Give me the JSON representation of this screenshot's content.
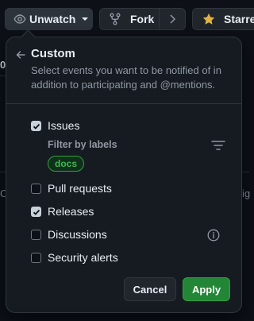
{
  "toolbar": {
    "watch_label": "Unwatch",
    "fork_label": "Fork",
    "star_label": "Starred"
  },
  "background": {
    "left_fragment_top": "0",
    "left_fragment_mid": "C",
    "right_fragment_mid": "ig"
  },
  "popover": {
    "title": "Custom",
    "description": "Select events you want to be notified of in addition to participating and @mentions.",
    "filter_label": "Filter by labels",
    "label_chip": "docs",
    "options": [
      {
        "label": "Issues",
        "checked": true
      },
      {
        "label": "Pull requests",
        "checked": false
      },
      {
        "label": "Releases",
        "checked": true
      },
      {
        "label": "Discussions",
        "checked": false
      },
      {
        "label": "Security alerts",
        "checked": false
      }
    ],
    "cancel_label": "Cancel",
    "apply_label": "Apply"
  },
  "colors": {
    "apply_bg": "#238636",
    "label_chip_border": "#2ea043",
    "label_chip_text": "#3fb950",
    "star_icon": "#e3b341"
  }
}
